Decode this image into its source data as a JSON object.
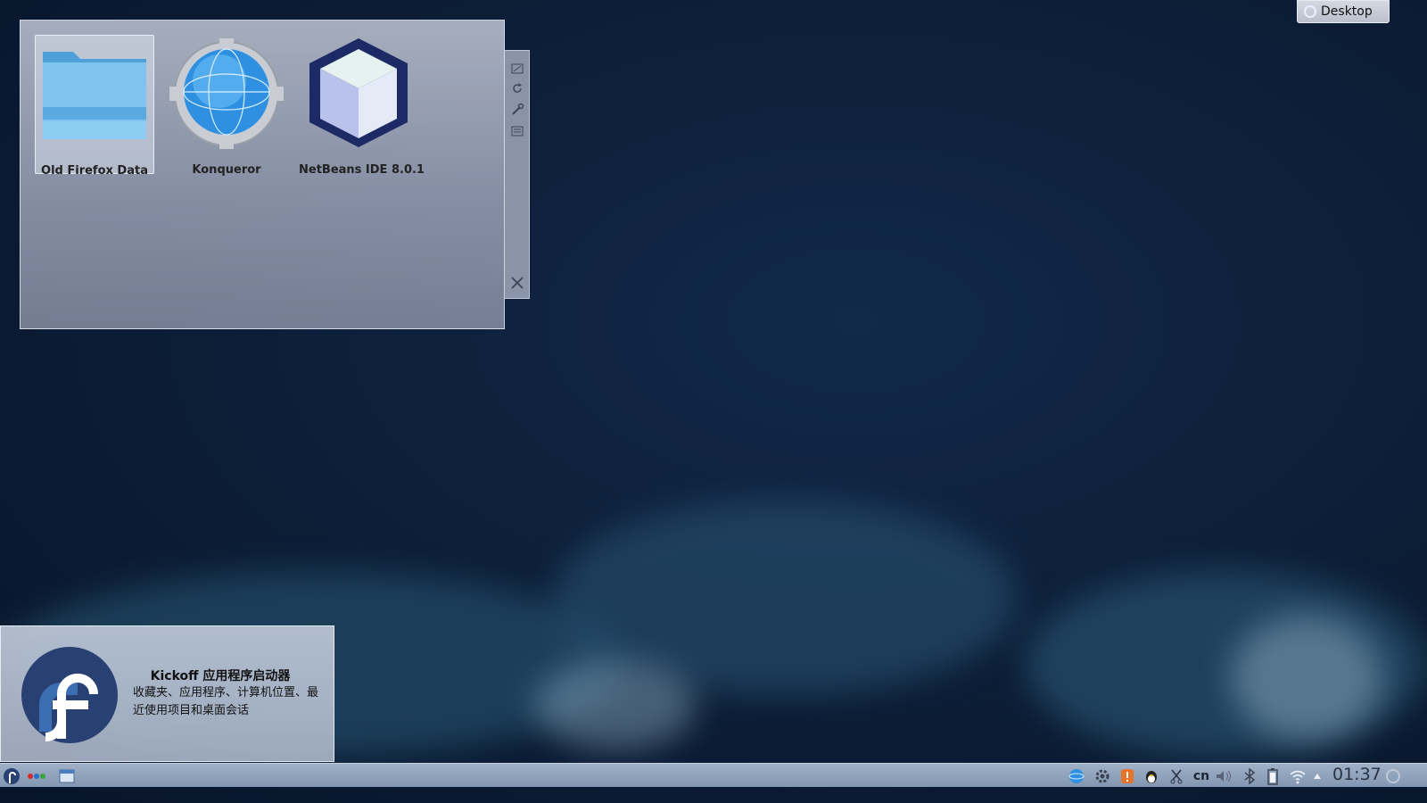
{
  "desktop": {
    "toolbox_label": "Desktop"
  },
  "folder_view": {
    "items": [
      {
        "label": "Old Firefox Data",
        "icon": "folder-icon",
        "selected": true
      },
      {
        "label": "Konqueror",
        "icon": "konqueror-globe-icon",
        "selected": false
      },
      {
        "label": "NetBeans IDE 8.0.1",
        "icon": "netbeans-cube-icon",
        "selected": false
      }
    ],
    "toolbar_icons": [
      "resize-icon",
      "rotate-icon",
      "settings-wrench-icon",
      "more-options-icon",
      "close-icon"
    ]
  },
  "tooltip": {
    "title": "Kickoff 应用程序启动器",
    "description": "收藏夹、应用程序、计算机位置、最近使用项目和桌面会话",
    "icon": "fedora-logo-icon"
  },
  "panel": {
    "launcher_icon": "fedora-launcher-icon",
    "pager_icon": "activities-dots-icon",
    "task_icon": "window-task-icon",
    "tray_icons": [
      "network-globe-icon",
      "system-settings-icon",
      "notification-alert-icon",
      "qq-penguin-icon",
      "klipper-scissors-icon",
      "volume-icon",
      "bluetooth-icon",
      "battery-icon",
      "wifi-icon",
      "tray-expand-arrow-icon"
    ],
    "keyboard_layout": "cn",
    "clock": "01:37"
  }
}
